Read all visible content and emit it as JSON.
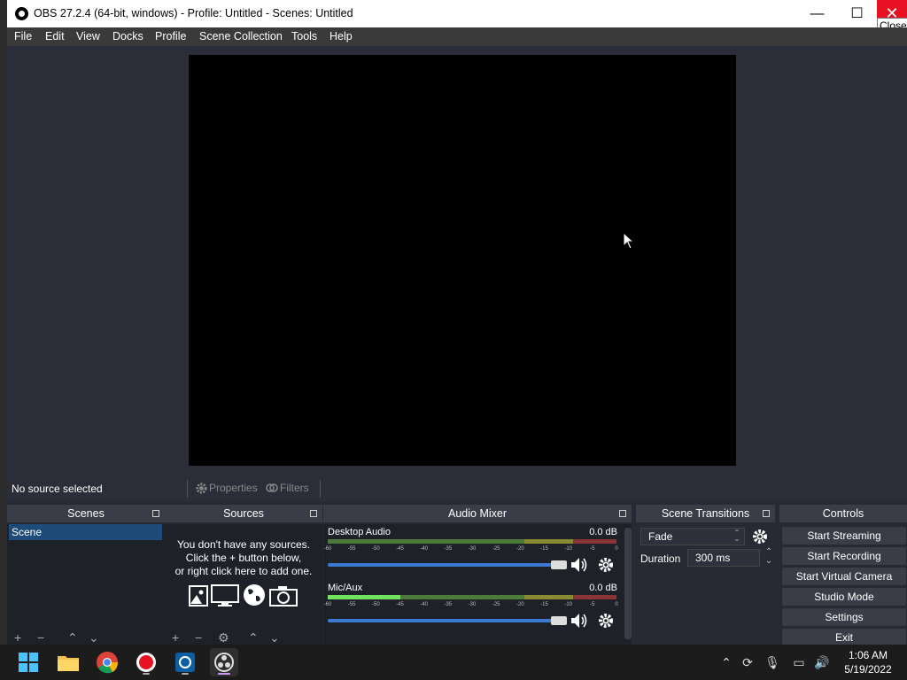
{
  "window": {
    "title": "OBS 27.2.4 (64-bit, windows) - Profile: Untitled - Scenes: Untitled",
    "close_tooltip": "Close",
    "min_glyph": "—",
    "max_glyph": "☐",
    "close_glyph": "✕"
  },
  "menu": [
    "File",
    "Edit",
    "View",
    "Docks",
    "Profile",
    "Scene Collection",
    "Tools",
    "Help"
  ],
  "source_toolbar": {
    "status": "No source selected",
    "properties": "Properties",
    "filters": "Filters"
  },
  "docks": {
    "scenes": {
      "title": "Scenes",
      "items": [
        "Scene"
      ]
    },
    "sources": {
      "title": "Sources",
      "empty_line1": "You don't have any sources.",
      "empty_line2": "Click the + button below,",
      "empty_line3": "or right click here to add one."
    },
    "mixer": {
      "title": "Audio Mixer",
      "ticks": [
        "-60",
        "-55",
        "-50",
        "-45",
        "-40",
        "-35",
        "-30",
        "-25",
        "-20",
        "-15",
        "-10",
        "-5",
        "0"
      ],
      "channels": [
        {
          "name": "Desktop Audio",
          "db": "0.0 dB",
          "level": 0.0,
          "volume": 1.0
        },
        {
          "name": "Mic/Aux",
          "db": "0.0 dB",
          "level": 0.25,
          "volume": 1.0
        }
      ]
    },
    "transitions": {
      "title": "Scene Transitions",
      "selected": "Fade",
      "duration_label": "Duration",
      "duration_value": "300 ms"
    },
    "controls": {
      "title": "Controls",
      "buttons": [
        "Start Streaming",
        "Start Recording",
        "Start Virtual Camera",
        "Studio Mode",
        "Settings",
        "Exit"
      ]
    }
  },
  "taskbar": {
    "time": "1:06 AM",
    "date": "5/19/2022"
  },
  "colors": {
    "accent": "#3a7ad2",
    "selection": "#1f4b78",
    "close_red": "#e81123"
  }
}
